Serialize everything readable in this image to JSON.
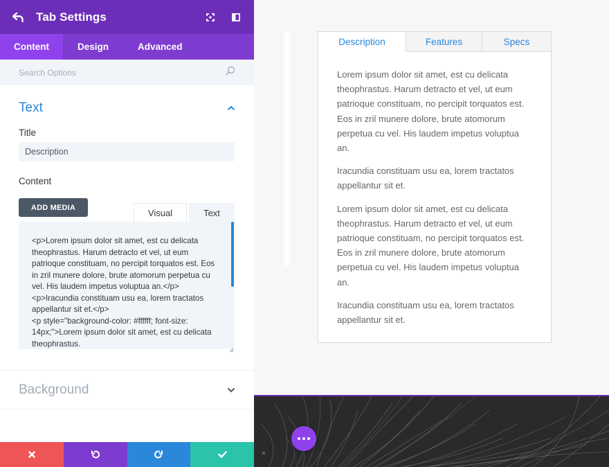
{
  "header": {
    "title": "Tab Settings",
    "back_icon": "back-arrow-icon",
    "icons": [
      "expand-icon",
      "sidebar-toggle-icon"
    ]
  },
  "tabs": [
    {
      "label": "Content",
      "active": true
    },
    {
      "label": "Design",
      "active": false
    },
    {
      "label": "Advanced",
      "active": false
    }
  ],
  "search": {
    "placeholder": "Search Options"
  },
  "text_section": {
    "title": "Text",
    "title_label": "Title",
    "title_value": "Description",
    "content_label": "Content",
    "add_media_label": "ADD MEDIA",
    "editor_tabs": {
      "visual": "Visual",
      "text": "Text"
    },
    "code": "<p>Lorem ipsum dolor sit amet, est cu delicata theophrastus. Harum detracto et vel, ut eum patrioque constituam, no percipit torquatos est. Eos in zril munere dolore, brute atomorum perpetua cu vel. His laudem impetus voluptua an.</p>\n<p>Iracundia constituam usu ea, lorem tractatos appellantur sit et.</p>\n<p style=\"background-color: #ffffff; font-size: 14px;\">Lorem ipsum dolor sit amet, est cu delicata theophrastus."
  },
  "background_section": {
    "title": "Background"
  },
  "footer": {
    "buttons": [
      "cancel-icon",
      "undo-icon",
      "redo-icon",
      "save-icon"
    ],
    "colors": [
      "#ef5555",
      "#7e3bd0",
      "#2b87da",
      "#29c4a9"
    ]
  },
  "preview": {
    "tabs": [
      {
        "label": "Description",
        "active": true
      },
      {
        "label": "Features",
        "active": false
      },
      {
        "label": "Specs",
        "active": false
      }
    ],
    "paragraphs": [
      "Lorem ipsum dolor sit amet, est cu delicata theophrastus. Harum detracto et vel, ut eum patrioque constituam, no percipit torquatos est. Eos in zril munere dolore, brute atomorum perpetua cu vel. His laudem impetus voluptua an.",
      "Iracundia constituam usu ea, lorem tractatos appellantur sit et.",
      "Lorem ipsum dolor sit amet, est cu delicata theophrastus. Harum detracto et vel, ut eum patrioque constituam, no percipit torquatos est. Eos in zril munere dolore, brute atomorum perpetua cu vel. His laudem impetus voluptua an.",
      "Iracundia constituam usu ea, lorem tractatos appellantur sit et."
    ]
  },
  "colors": {
    "header_purple": "#6c2eb9",
    "tab_bar_purple": "#7e3bd0",
    "active_tab_purple": "#8f42ec",
    "accent_blue": "#2b87da"
  }
}
